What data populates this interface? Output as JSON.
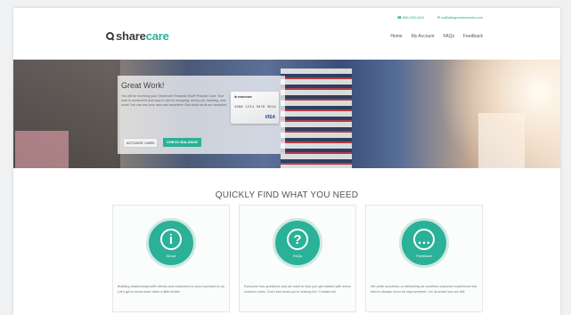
{
  "topbar": {
    "phone": "☎ 866-228-4411",
    "email": "✉ cs@allsignaturecards.com"
  },
  "brand": {
    "prefix": "share",
    "suffix": "care"
  },
  "nav": [
    "Home",
    "My Account",
    "FAQs",
    "Feedback"
  ],
  "hero": {
    "title": "Great Work!",
    "body": "You will be receiving your Sharecare Rewards Visa® Prepaid Card. Your card is convenient and easy to use for shopping, dining out, traveling, and more! You can use your new card anywhere Visa debit cards are accepted.",
    "card": {
      "brand": "⊕ sharecare",
      "number": "4000 1234 5678 9010",
      "network": "VISA"
    },
    "activate_label": "ACTIVATE CARD",
    "check_label": "CHECK BALANCE"
  },
  "section": {
    "title": "QUICKLY FIND WHAT YOU NEED"
  },
  "tiles": [
    {
      "glyph": "i",
      "label": "About",
      "text": "Building relationships with clients and customers is very important to us. Let's get to know each other a little better!"
    },
    {
      "glyph": "?",
      "label": "FAQs",
      "text": "Everyone has questions and we want to help you get started with some common ones. Don't see what you're looking for? Contact us!"
    },
    {
      "glyph": "…",
      "label": "Feedback",
      "text": "We pride ourselves on delivering an excellent customer experience but there's always room for improvement. Let us know how we did!"
    }
  ],
  "colors": {
    "accent": "#2bb197",
    "text": "#555555"
  }
}
